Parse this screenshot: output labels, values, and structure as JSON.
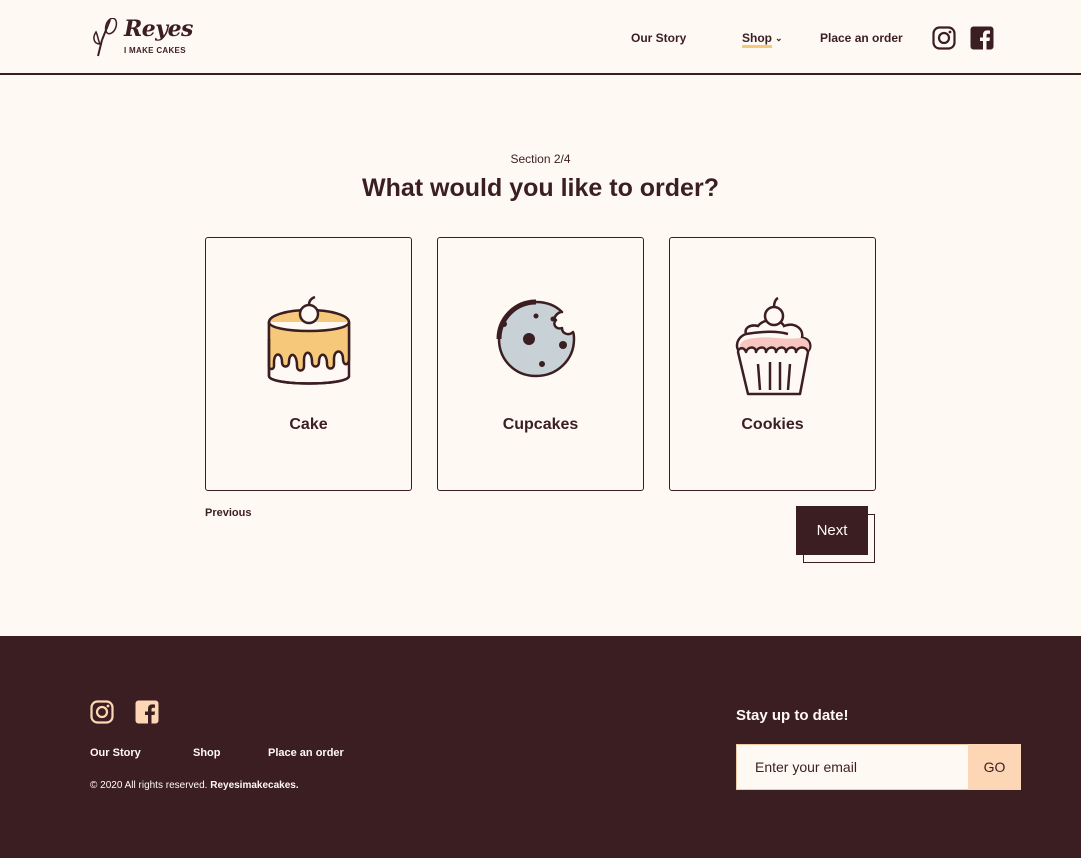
{
  "brand": {
    "name": "Reyes",
    "tagline": "I MAKE CAKES"
  },
  "nav": {
    "story": "Our Story",
    "shop": "Shop",
    "order": "Place an order"
  },
  "section": {
    "label": "Section 2/4",
    "question": "What would you like to order?"
  },
  "options": [
    {
      "label": "Cake",
      "icon": "cake-icon"
    },
    {
      "label": "Cupcakes",
      "icon": "cookie-icon"
    },
    {
      "label": "Cookies",
      "icon": "cupcake-icon"
    }
  ],
  "buttons": {
    "previous": "Previous",
    "next": "Next"
  },
  "footer": {
    "links": {
      "story": "Our Story",
      "shop": "Shop",
      "order": "Place an order"
    },
    "copyright": "© 2020 All rights reserved. ",
    "copyright_brand": "Reyesimakecakes.",
    "newsletter_title": "Stay up to date!",
    "email_placeholder": "Enter your email",
    "go": "GO"
  },
  "colors": {
    "primary": "#3b1e21",
    "background": "#fff9f4",
    "accent": "#f6c97a",
    "button_peach": "#fdd7b5"
  }
}
